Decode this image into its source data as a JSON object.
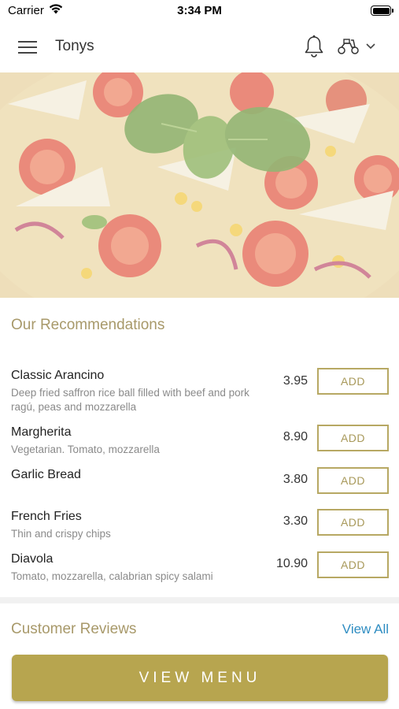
{
  "status_bar": {
    "carrier": "Carrier",
    "time": "3:34 PM",
    "wifi_icon": "wifi-icon",
    "battery_icon": "battery-icon"
  },
  "header": {
    "title": "Tonys",
    "menu_icon": "hamburger-menu-icon",
    "notification_icon": "bell-icon",
    "delivery_icon": "scooter-icon",
    "dropdown_icon": "chevron-down-icon"
  },
  "hero": {
    "image": "pizza-photo"
  },
  "recommendations": {
    "title": "Our Recommendations",
    "add_label": "ADD",
    "items": [
      {
        "name": "Classic Arancino",
        "description": "Deep fried saffron rice ball filled with beef and pork ragú, peas and mozzarella",
        "price": "3.95"
      },
      {
        "name": "Margherita",
        "description": "Vegetarian. Tomato, mozzarella",
        "price": "8.90"
      },
      {
        "name": "Garlic Bread",
        "description": "",
        "price": "3.80"
      },
      {
        "name": "French Fries",
        "description": "Thin and crispy chips",
        "price": "3.30"
      },
      {
        "name": "Diavola",
        "description": "Tomato, mozzarella, calabrian spicy salami",
        "price": "10.90"
      }
    ]
  },
  "reviews": {
    "title": "Customer Reviews",
    "view_all": "View All"
  },
  "cta": {
    "label": "VIEW MENU"
  },
  "colors": {
    "accent": "#b7a54f",
    "accent_text": "#a8996a",
    "link": "#2f8dc2"
  }
}
